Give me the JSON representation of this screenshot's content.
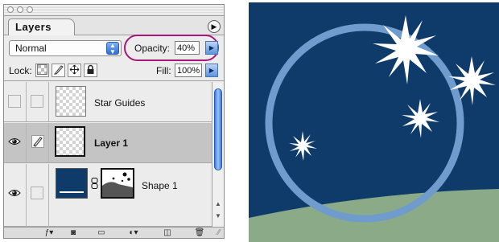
{
  "palette": {
    "tab_label": "Layers",
    "blend_mode": "Normal",
    "opacity_label": "Opacity:",
    "opacity_value": "40%",
    "lock_label": "Lock:",
    "fill_label": "Fill:",
    "fill_value": "100%",
    "layers": [
      {
        "name": "Star Guides",
        "visible": false,
        "selected": false
      },
      {
        "name": "Layer 1",
        "visible": true,
        "selected": true
      },
      {
        "name": "Shape 1",
        "visible": true,
        "selected": false
      }
    ]
  },
  "icons": {
    "eye": "eye-icon",
    "brush": "brush-icon",
    "chain": "link-icon",
    "move": "move-icon",
    "lock": "lock-icon",
    "menu": "palette-menu-icon"
  },
  "colors": {
    "canvas_background": "#0f3b6a",
    "ring": "#6f9ccc",
    "annotation": "#a7167a",
    "selected_row": "#c4c4c4"
  }
}
